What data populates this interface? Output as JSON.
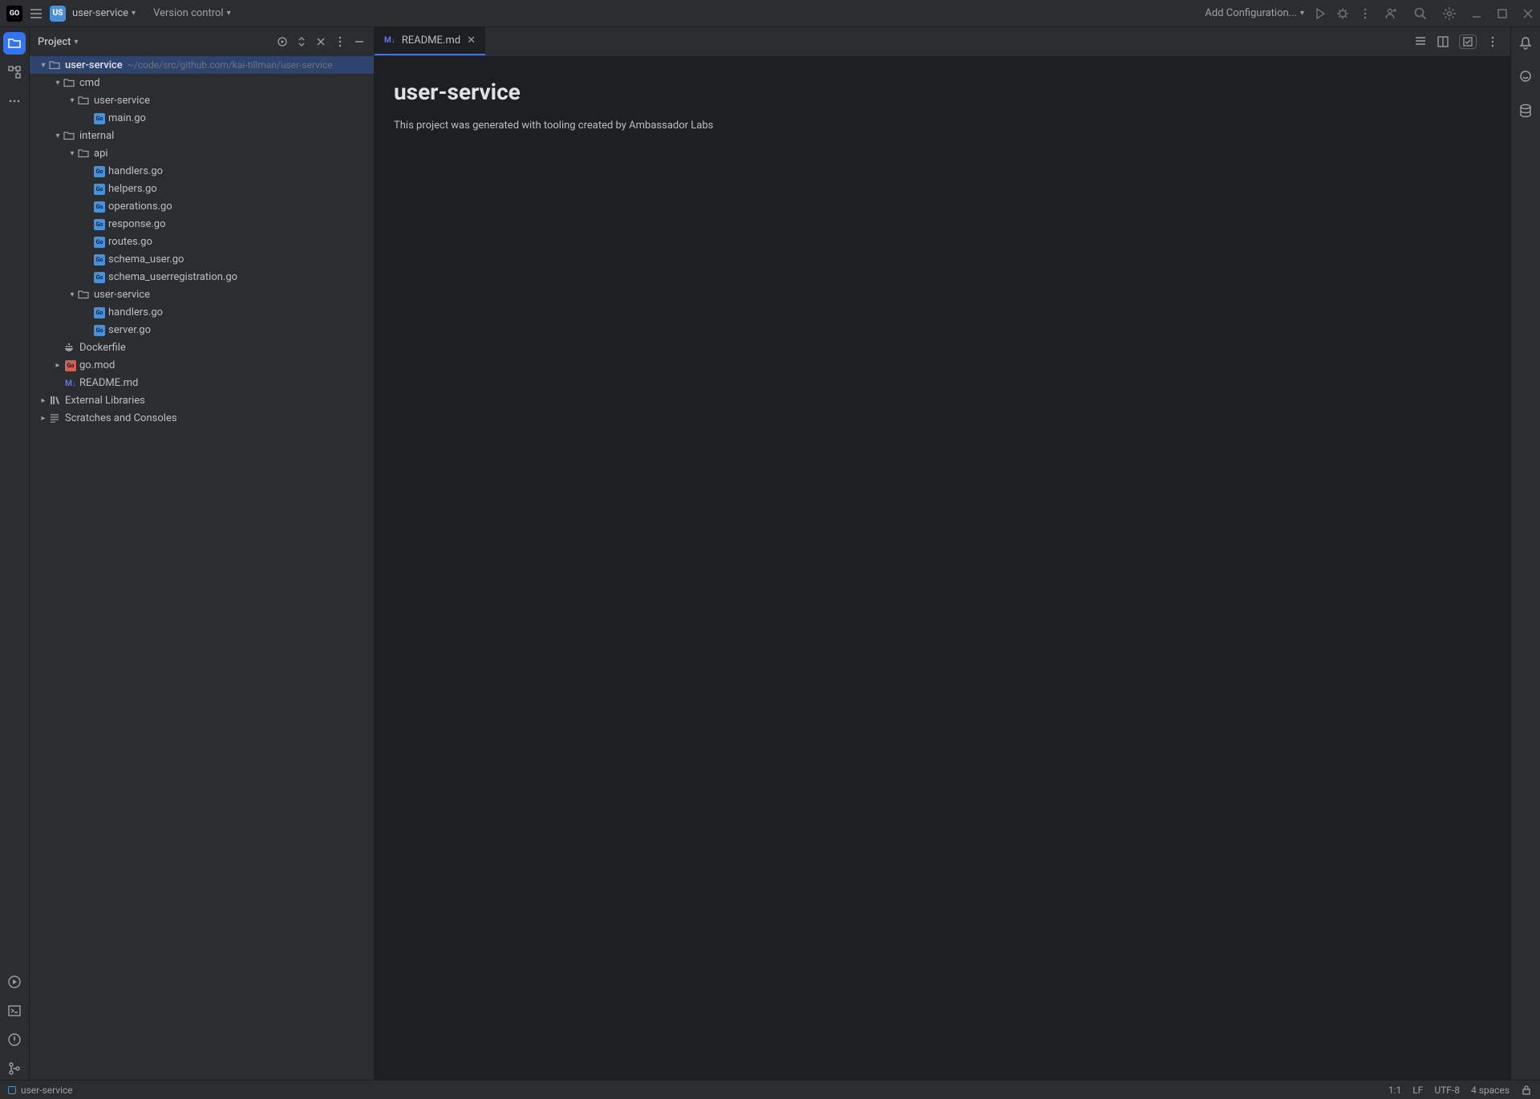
{
  "titlebar": {
    "logo": "GO",
    "project_badge": "US",
    "project_name": "user-service",
    "vc_label": "Version control",
    "add_config": "Add Configuration..."
  },
  "project_panel": {
    "title": "Project"
  },
  "tree": {
    "root_name": "user-service",
    "root_path": "~/code/src/github.com/kai-tillman/user-service",
    "cmd": "cmd",
    "cmd_user": "user-service",
    "main_go": "main.go",
    "internal": "internal",
    "api": "api",
    "api_files": [
      "handlers.go",
      "helpers.go",
      "operations.go",
      "response.go",
      "routes.go",
      "schema_user.go",
      "schema_userregistration.go"
    ],
    "internal_user": "user-service",
    "internal_user_files": [
      "handlers.go",
      "server.go"
    ],
    "dockerfile": "Dockerfile",
    "gomod": "go.mod",
    "readme": "README.md",
    "ext_lib": "External Libraries",
    "scratch": "Scratches and Consoles"
  },
  "tab": {
    "label": "README.md"
  },
  "editor": {
    "h1": "user-service",
    "p": "This project was generated with tooling created by Ambassador Labs"
  },
  "status": {
    "branch": "user-service",
    "pos": "1:1",
    "lf": "LF",
    "enc": "UTF-8",
    "indent": "4 spaces"
  }
}
